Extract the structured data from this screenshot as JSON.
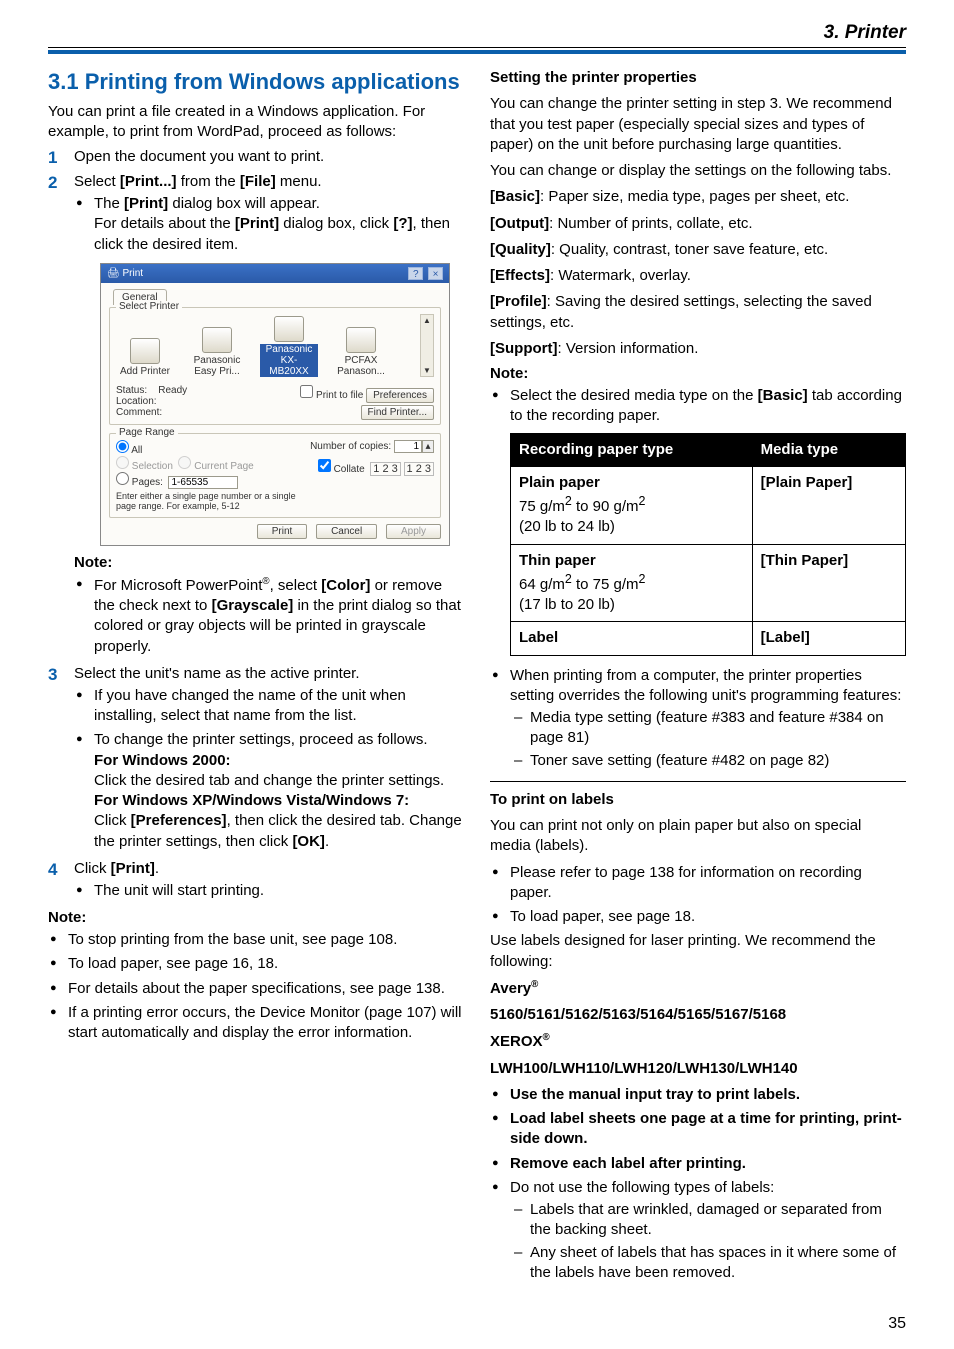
{
  "chapter": "3. Printer",
  "pageNumber": "35",
  "left": {
    "heading": "3.1 Printing from Windows applications",
    "intro": "You can print a file created in a Windows application. For example, to print from WordPad, proceed as follows:",
    "step1": "Open the document you want to print.",
    "step2_main": "Select [Print...] from the [File] menu.",
    "step2_bullets": [
      "The [Print] dialog box will appear.\nFor details about the [Print] dialog box, click [?], then click the desired item."
    ],
    "dialog": {
      "title": "Print",
      "tab": "General",
      "group_printer": "Select Printer",
      "printers": [
        {
          "label": "Add Printer"
        },
        {
          "label": "Panasonic Easy Pri..."
        },
        {
          "label": "Panasonic KX-MB20XX",
          "selected": true
        },
        {
          "label": "PCFAX Panason..."
        }
      ],
      "status_lbl": "Status:",
      "status_val": "Ready",
      "location_lbl": "Location:",
      "comment_lbl": "Comment:",
      "print_to_file": "Print to file",
      "preferences_btn": "Preferences",
      "find_printer_btn": "Find Printer...",
      "group_range": "Page Range",
      "range_all": "All",
      "range_selection": "Selection",
      "range_current": "Current Page",
      "range_pages": "Pages:",
      "range_pages_val": "1-65535",
      "range_hint": "Enter either a single page number or a single page range.  For example, 5-12",
      "copies_lbl": "Number of copies:",
      "copies_val": "1",
      "collate_lbl": "Collate",
      "btn_print": "Print",
      "btn_cancel": "Cancel",
      "btn_apply": "Apply"
    },
    "note1_lbl": "Note:",
    "note1_bullets": [
      "For Microsoft PowerPoint®, select [Color] or remove the check next to [Grayscale] in the print dialog so that colored or gray objects will be printed in grayscale properly."
    ],
    "step3_main": "Select the unit's name as the active printer.",
    "step3_bullets": {
      "b1": "If you have changed the name of the unit when installing, select that name from the list.",
      "b2": "To change the printer settings, proceed as follows.",
      "win2000_h": "For Windows 2000:",
      "win2000_t": "Click the desired tab and change the printer settings.",
      "winxp_h": "For Windows XP/Windows Vista/Windows 7:",
      "winxp_t": "Click [Preferences], then click the desired tab. Change the printer settings, then click [OK]."
    },
    "step4_main": "Click [Print].",
    "step4_bullets": [
      "The unit will start printing."
    ],
    "note2_lbl": "Note:",
    "note2_bullets": [
      "To stop printing from the base unit, see page 108.",
      "To load paper, see page 16, 18.",
      "For details about the paper specifications, see page 138.",
      "If a printing error occurs, the Device Monitor (page 107) will start automatically and display the error information."
    ]
  },
  "right": {
    "props_h": "Setting the printer properties",
    "props_p1": "You can change the printer setting in step 3. We recommend that you test paper (especially special sizes and types of paper) on the unit before purchasing large quantities.",
    "props_p2": "You can change or display the settings on the following tabs.",
    "tabs": {
      "basic": "[Basic]: Paper size, media type, pages per sheet, etc.",
      "output": "[Output]: Number of prints, collate, etc.",
      "quality": "[Quality]: Quality, contrast, toner save feature, etc.",
      "effects": "[Effects]: Watermark, overlay.",
      "profile": "[Profile]: Saving the desired settings, selecting the saved settings, etc.",
      "support": "[Support]: Version information."
    },
    "note3_lbl": "Note:",
    "note3_b1": "Select the desired media type on the [Basic] tab according to the recording paper.",
    "table": {
      "th1": "Recording paper type",
      "th2": "Media type",
      "r1c1_h": "Plain paper",
      "r1c1_t": "75 g/m² to 90 g/m²\n(20 lb to 24 lb)",
      "r1c2": "[Plain Paper]",
      "r2c1_h": "Thin paper",
      "r2c1_t": "64 g/m² to 75 g/m²\n(17 lb to 20 lb)",
      "r2c2": "[Thin Paper]",
      "r3c1": "Label",
      "r3c2": "[Label]"
    },
    "override_b": "When printing from a computer, the printer properties setting overrides the following unit's programming features:",
    "override_dashes": [
      "Media type setting (feature #383 and feature #384 on page 81)",
      "Toner save setting (feature #482 on page 82)"
    ],
    "labels_h": "To print on labels",
    "labels_p": "You can print not only on plain paper but also on special media (labels).",
    "labels_b1": "Please refer to page 138 for information on recording paper.",
    "labels_b2": "To load paper, see page 18.",
    "labels_p2": "Use labels designed for laser printing. We recommend the following:",
    "avery_h": "Avery®",
    "avery_nums": "5160/5161/5162/5163/5164/5165/5167/5168",
    "xerox_h": "XEROX®",
    "xerox_nums": "LWH100/LWH110/LWH120/LWH130/LWH140",
    "final_b1": "Use the manual input tray to print labels.",
    "final_b2": "Load label sheets one page at a time for printing, print-side down.",
    "final_b3": "Remove each label after printing.",
    "final_b4": "Do not use the following types of labels:",
    "final_dashes": [
      "Labels that are wrinkled, damaged or separated from the backing sheet.",
      "Any sheet of labels that has spaces in it where some of the labels have been removed."
    ]
  }
}
